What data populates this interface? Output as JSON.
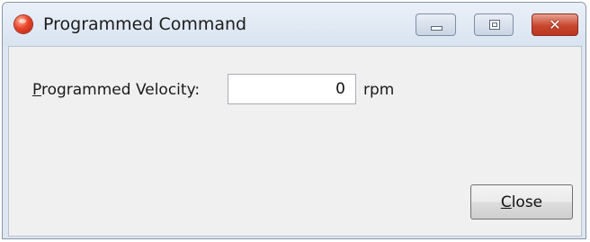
{
  "window": {
    "title": "Programmed Command",
    "app_icon": "app-icon",
    "controls": {
      "minimize_icon": "minimize-icon",
      "maximize_icon": "maximize-icon",
      "close_icon": "close-icon",
      "close_glyph": "✕"
    }
  },
  "form": {
    "velocity_label_mnemonic": "P",
    "velocity_label_rest": "rogrammed Velocity:",
    "velocity_value": "0",
    "velocity_unit": "rpm"
  },
  "actions": {
    "close_mnemonic": "C",
    "close_rest": "lose"
  },
  "colors": {
    "titlebar": "#dde6f1",
    "client": "#f0f0f0",
    "close_caption": "#c9472f"
  }
}
